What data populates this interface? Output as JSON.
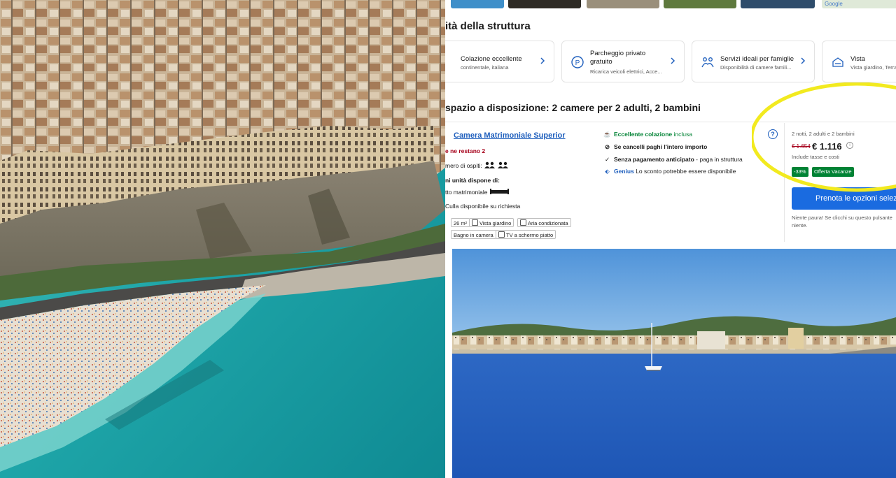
{
  "section": {
    "title": "ità della struttura"
  },
  "features": [
    {
      "title": "Colazione eccellente",
      "subtitle": "continentale, italiana",
      "icon": "coffee-icon"
    },
    {
      "title": "Parcheggio privato gratuito",
      "subtitle": "Ricarica veicoli elettrici, Acce...",
      "icon": "parking-icon"
    },
    {
      "title": "Servizi ideali per famiglie",
      "subtitle": "Disponibilità di camere famili...",
      "icon": "family-icon"
    },
    {
      "title": "Vista",
      "subtitle": "Vista giardino, Terra",
      "icon": "view-icon"
    }
  ],
  "rooms": {
    "title": "spazio a disposizione: 2 camere per 2 adulti, 2 bambini",
    "room_name": "Camera Matrimoniale Superior",
    "scarcity": "e ne restano 2",
    "guests_label": "mero di ospiti:",
    "unit_label": "ni unità dispone di:",
    "bed": "tto matrimoniale",
    "crib": "Culla disponibile su richiesta",
    "amenities_row1": [
      "26 m²",
      "Vista giardino",
      "Aria condizionata"
    ],
    "amenities_row2": [
      "Bagno in camera",
      "TV a schermo piatto"
    ],
    "conditions": {
      "breakfast_strong": "Eccellente colazione",
      "breakfast_rest": "inclusa",
      "cancel": "Se cancelli paghi l'intero importo",
      "prepay_strong": "Senza pagamento anticipato",
      "prepay_rest": "- paga in struttura",
      "genius_label": "Genius",
      "genius_text": "Lo sconto potrebbe essere disponibile"
    }
  },
  "price": {
    "stay": "2 notti, 2 adulti e 2 bambini",
    "old_price": "€ 1.654",
    "new_price": "€ 1.116",
    "taxes": "Include tasse e costi",
    "discount": "-33%",
    "deal": "Offerta Vacanze",
    "book_label": "Prenota le opzioni selezionate",
    "note_line1": "Niente paura! Se clicchi su questo pulsante",
    "note_line2": "niente."
  },
  "map_thumb": "Google",
  "colors": {
    "link_blue": "#1f5fbd",
    "button_blue": "#1a6be0",
    "deal_green": "#008234",
    "scarcity_red": "#a6001a",
    "highlight_yellow": "#f2ea1f"
  }
}
